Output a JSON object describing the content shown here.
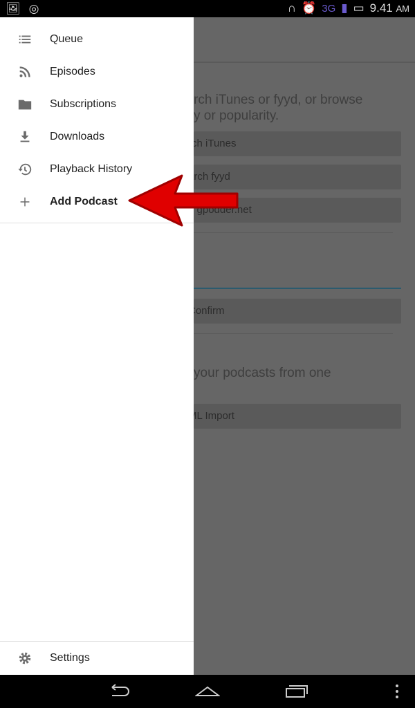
{
  "status_bar": {
    "time": "9.41",
    "ampm": "AM",
    "network": "3G",
    "icons": [
      "image-icon",
      "music-icon",
      "headset-icon",
      "alarm-icon",
      "signal-icon",
      "battery-icon"
    ]
  },
  "background": {
    "description_line1": "rch iTunes or fyyd, or browse",
    "description_line2": "y or popularity.",
    "search_itunes": "rch iTunes",
    "search_fyyd": "arch fyyd",
    "gpodder": "e gpodder.net",
    "confirm": "Confirm",
    "import_text": "your podcasts from one",
    "opml_import": "ML Import",
    "accent": "#2b5b6e"
  },
  "drawer": {
    "items": [
      {
        "label": "Queue",
        "icon": "queue-icon"
      },
      {
        "label": "Episodes",
        "icon": "rss-icon"
      },
      {
        "label": "Subscriptions",
        "icon": "folder-icon"
      },
      {
        "label": "Downloads",
        "icon": "download-icon"
      },
      {
        "label": "Playback History",
        "icon": "history-icon"
      },
      {
        "label": "Add Podcast",
        "icon": "plus-icon",
        "selected": true
      }
    ],
    "settings": {
      "label": "Settings",
      "icon": "gear-icon"
    }
  },
  "annotation": {
    "arrow_color": "#e00000"
  }
}
